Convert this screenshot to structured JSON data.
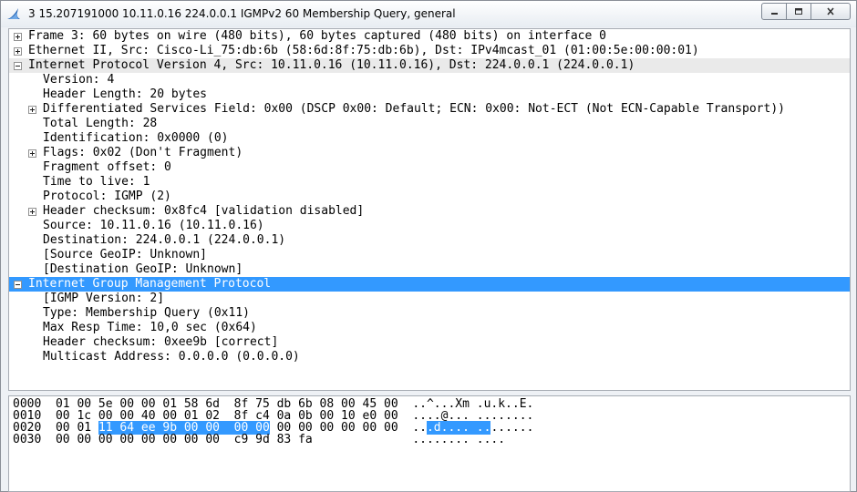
{
  "window": {
    "title": "3 15.207191000 10.11.0.16 224.0.0.1 IGMPv2 60 Membership Query, general"
  },
  "tree": [
    {
      "text": "Frame 3: 60 bytes on wire (480 bits), 60 bytes captured (480 bits) on interface 0",
      "level": 0,
      "expander": "plus"
    },
    {
      "text": "Ethernet II, Src: Cisco-Li_75:db:6b (58:6d:8f:75:db:6b), Dst: IPv4mcast_01 (01:00:5e:00:00:01)",
      "level": 0,
      "expander": "plus"
    },
    {
      "text": "Internet Protocol Version 4, Src: 10.11.0.16 (10.11.0.16), Dst: 224.0.0.1 (224.0.0.1)",
      "level": 0,
      "expander": "minus"
    },
    {
      "text": "Version: 4",
      "level": 1,
      "expander": "none"
    },
    {
      "text": "Header Length: 20 bytes",
      "level": 1,
      "expander": "none"
    },
    {
      "text": "Differentiated Services Field: 0x00 (DSCP 0x00: Default; ECN: 0x00: Not-ECT (Not ECN-Capable Transport))",
      "level": 1,
      "expander": "plus"
    },
    {
      "text": "Total Length: 28",
      "level": 1,
      "expander": "none"
    },
    {
      "text": "Identification: 0x0000 (0)",
      "level": 1,
      "expander": "none"
    },
    {
      "text": "Flags: 0x02 (Don't Fragment)",
      "level": 1,
      "expander": "plus"
    },
    {
      "text": "Fragment offset: 0",
      "level": 1,
      "expander": "none"
    },
    {
      "text": "Time to live: 1",
      "level": 1,
      "expander": "none"
    },
    {
      "text": "Protocol: IGMP (2)",
      "level": 1,
      "expander": "none"
    },
    {
      "text": "Header checksum: 0x8fc4 [validation disabled]",
      "level": 1,
      "expander": "plus"
    },
    {
      "text": "Source: 10.11.0.16 (10.11.0.16)",
      "level": 1,
      "expander": "none"
    },
    {
      "text": "Destination: 224.0.0.1 (224.0.0.1)",
      "level": 1,
      "expander": "none"
    },
    {
      "text": "[Source GeoIP: Unknown]",
      "level": 1,
      "expander": "none"
    },
    {
      "text": "[Destination GeoIP: Unknown]",
      "level": 1,
      "expander": "none"
    },
    {
      "text": "Internet Group Management Protocol",
      "level": 0,
      "expander": "minus",
      "selected": true
    },
    {
      "text": "[IGMP Version: 2]",
      "level": 1,
      "expander": "none"
    },
    {
      "text": "Type: Membership Query (0x11)",
      "level": 1,
      "expander": "none"
    },
    {
      "text": "Max Resp Time: 10,0 sec (0x64)",
      "level": 1,
      "expander": "none"
    },
    {
      "text": "Header checksum: 0xee9b [correct]",
      "level": 1,
      "expander": "none"
    },
    {
      "text": "Multicast Address: 0.0.0.0 (0.0.0.0)",
      "level": 1,
      "expander": "none"
    }
  ],
  "hex": [
    {
      "offset": "0000",
      "bytes_pre": "01 00 5e 00 00 01 58 6d  8f 75 db 6b 08 00 45 00",
      "bytes_sel": "",
      "bytes_post": "",
      "ascii_pre": "..^...Xm .u.k..E.",
      "ascii_sel": "",
      "ascii_post": ""
    },
    {
      "offset": "0010",
      "bytes_pre": "00 1c 00 00 40 00 01 02  8f c4 0a 0b 00 10 e0 00",
      "bytes_sel": "",
      "bytes_post": "",
      "ascii_pre": "....@... ........",
      "ascii_sel": "",
      "ascii_post": ""
    },
    {
      "offset": "0020",
      "bytes_pre": "00 01 ",
      "bytes_sel": "11 64 ee 9b 00 00  00 00",
      "bytes_post": " 00 00 00 00 00 00",
      "ascii_pre": "..",
      "ascii_sel": ".d.... ..",
      "ascii_post": "......"
    },
    {
      "offset": "0030",
      "bytes_pre": "00 00 00 00 00 00 00 00  c9 9d 83 fa",
      "bytes_sel": "",
      "bytes_post": "",
      "ascii_pre": "........ ....",
      "ascii_sel": "",
      "ascii_post": ""
    }
  ],
  "colors": {
    "selection": "#3399ff",
    "pane_bg": "#ffffff",
    "window_bg": "#eef1f5"
  }
}
